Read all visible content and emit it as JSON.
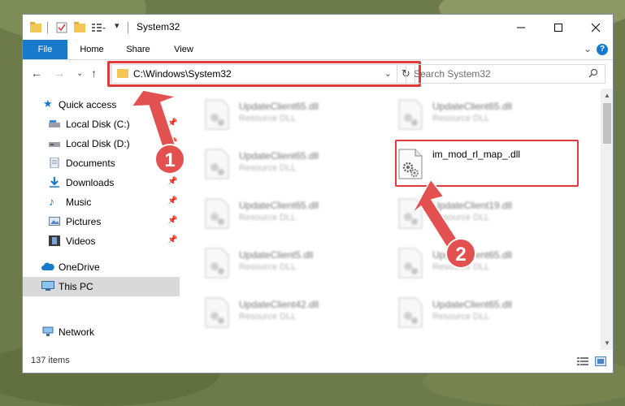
{
  "window": {
    "title": "System32",
    "controls": {
      "minimize": "minimize-icon",
      "maximize": "maximize-icon",
      "close": "close-icon"
    }
  },
  "ribbon": {
    "tabs": [
      {
        "label": "File"
      },
      {
        "label": "Home"
      },
      {
        "label": "Share"
      },
      {
        "label": "View"
      }
    ],
    "help": "?"
  },
  "nav": {
    "address": "C:\\Windows\\System32",
    "search_placeholder": "Search System32"
  },
  "sidebar": {
    "items": [
      {
        "label": "Quick access",
        "icon": "star-icon"
      },
      {
        "label": "Local Disk (C:)",
        "icon": "drive-icon",
        "pinned": true
      },
      {
        "label": "Local Disk (D:)",
        "icon": "drive-icon",
        "pinned": true
      },
      {
        "label": "Documents",
        "icon": "documents-icon",
        "pinned": true
      },
      {
        "label": "Downloads",
        "icon": "download-icon",
        "pinned": true
      },
      {
        "label": "Music",
        "icon": "music-icon",
        "pinned": true
      },
      {
        "label": "Pictures",
        "icon": "pictures-icon",
        "pinned": true
      },
      {
        "label": "Videos",
        "icon": "videos-icon",
        "pinned": true
      },
      {
        "label": "OneDrive",
        "icon": "cloud-icon"
      },
      {
        "label": "This PC",
        "icon": "computer-icon",
        "selected": true
      },
      {
        "label": "Network",
        "icon": "network-icon"
      }
    ]
  },
  "files": {
    "left_column": [
      {
        "name": "UpdateClient65.dll",
        "type": "Resource DLL"
      },
      {
        "name": "UpdateClient65.dll",
        "type": "Resource DLL"
      },
      {
        "name": "UpdateClient65.dll",
        "type": "Resource DLL"
      },
      {
        "name": "UpdateClient5.dll",
        "type": "Resource DLL"
      },
      {
        "name": "UpdateClient42.dll",
        "type": "Resource DLL"
      }
    ],
    "right_column": [
      {
        "name": "UpdateClient65.dll",
        "type": "Resource DLL"
      },
      {
        "name": "im_mod_rl_map_.dll",
        "type": "",
        "highlighted": true
      },
      {
        "name": "UpdateClient19.dll",
        "type": "Resource DLL"
      },
      {
        "name": "UpdateClient65.dll",
        "type": "Resource DLL"
      },
      {
        "name": "UpdateClient65.dll",
        "type": "Resource DLL"
      }
    ]
  },
  "status": {
    "items_count": "137 items"
  },
  "annotations": {
    "step1": "1",
    "step2": "2",
    "highlight_color": "#e03a3a"
  },
  "colors": {
    "accent": "#1979ca",
    "folder": "#f2c756"
  }
}
